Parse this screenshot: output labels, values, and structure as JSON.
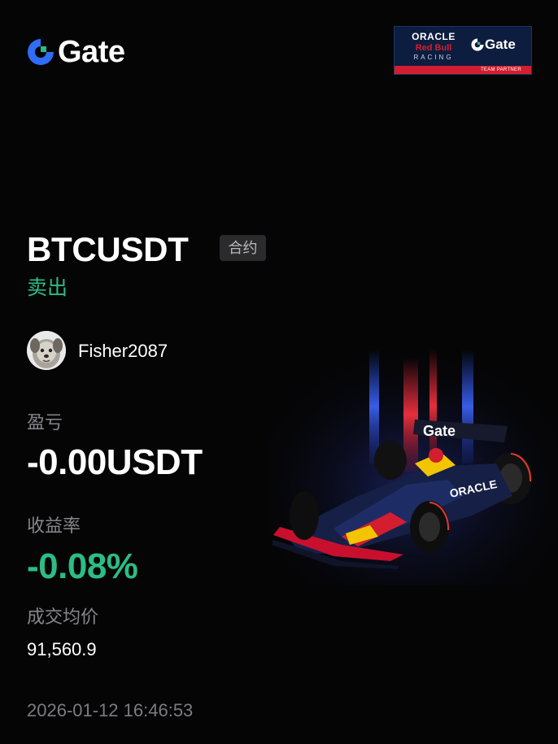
{
  "brand": {
    "name": "Gate",
    "icon": "gate-logo-icon",
    "accent": "#2f6df6"
  },
  "sponsor": {
    "line1": "ORACLE",
    "line2": "Red Bull",
    "line3": "RACING",
    "partner_name": "Gate",
    "strip": "TEAM PARTNER",
    "colors": {
      "background": "#0d1d3f",
      "red": "#d31e2f"
    }
  },
  "trade": {
    "symbol": "BTCUSDT",
    "type_badge": "合约",
    "side": "卖出",
    "side_color": "#2bbd85"
  },
  "user": {
    "username": "Fisher2087",
    "avatar_icon": "dog-avatar-icon"
  },
  "stats": {
    "pnl_label": "盈亏",
    "pnl_value": "-0.00USDT",
    "roi_label": "收益率",
    "roi_value": "-0.08%",
    "price_label": "成交均价",
    "price_value": "91,560.9"
  },
  "timestamp": "2026-01-12 16:46:53",
  "art": {
    "icon": "f1-race-car-icon",
    "car_wing_text": "Gate",
    "car_side_text": "ORACLE"
  }
}
